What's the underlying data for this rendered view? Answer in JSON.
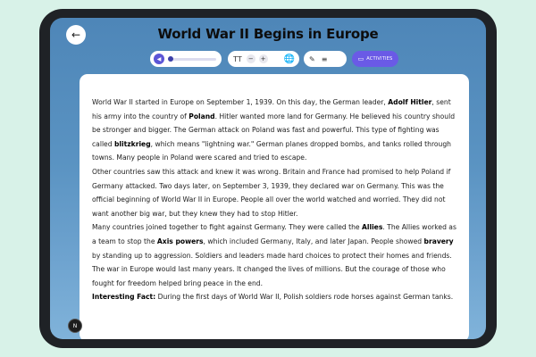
{
  "header": {
    "title": "World War II Begins in Europe",
    "back_icon": "arrow-left-icon",
    "back_glyph": "←"
  },
  "toolbar": {
    "play_glyph": "◀",
    "audio_progress": 0.0,
    "font_icon_glyph": "TT",
    "decrease_glyph": "−",
    "increase_glyph": "+",
    "globe_glyph": "🌐",
    "edit_glyph": "✎",
    "list_glyph": "≡",
    "activities_glyph": "▭",
    "activities_label": "ACTIVITIES"
  },
  "article": {
    "p1": [
      {
        "t": "World War II started in Europe on September 1, 1939. On this day, the German leader, ",
        "b": false
      },
      {
        "t": "Adolf Hitler",
        "b": true
      },
      {
        "t": ", sent his army into the country of ",
        "b": false
      },
      {
        "t": "Poland",
        "b": true
      },
      {
        "t": ". Hitler wanted more land for Germany. He believed his country should be stronger and bigger. The German attack on Poland was fast and powerful. This type of fighting was called ",
        "b": false
      },
      {
        "t": "blitzkrieg",
        "b": true
      },
      {
        "t": ", which means \"lightning war.\" German planes dropped bombs, and tanks rolled through towns. Many people in Poland were scared and tried to escape.",
        "b": false
      }
    ],
    "p2": [
      {
        "t": "Other countries saw this attack and knew it was wrong. Britain and France had promised to help Poland if Germany attacked. Two days later, on September 3, 1939, they declared war on Germany. This was the official beginning of World War II in Europe. People all over the world watched and worried. They did not want another big war, but they knew they had to stop Hitler.",
        "b": false
      }
    ],
    "p3": [
      {
        "t": "Many countries joined together to fight against Germany. They were called the ",
        "b": false
      },
      {
        "t": "Allies",
        "b": true
      },
      {
        "t": ". The Allies worked as a team to stop the ",
        "b": false
      },
      {
        "t": "Axis powers",
        "b": true
      },
      {
        "t": ", which included Germany, Italy, and later Japan. People showed ",
        "b": false
      },
      {
        "t": "bravery",
        "b": true
      },
      {
        "t": " by standing up to aggression. Soldiers and leaders made hard choices to protect their homes and friends.",
        "b": false
      }
    ],
    "p4": [
      {
        "t": "The war in Europe would last many years. It changed the lives of millions. But the courage of those who fought for freedom helped bring peace in the end.",
        "b": false
      }
    ],
    "p5": [
      {
        "t": "Interesting Fact:",
        "b": true
      },
      {
        "t": " During the first days of World War II, Polish soldiers rode horses against German tanks.",
        "b": false
      }
    ]
  },
  "badge": {
    "label": "N"
  }
}
